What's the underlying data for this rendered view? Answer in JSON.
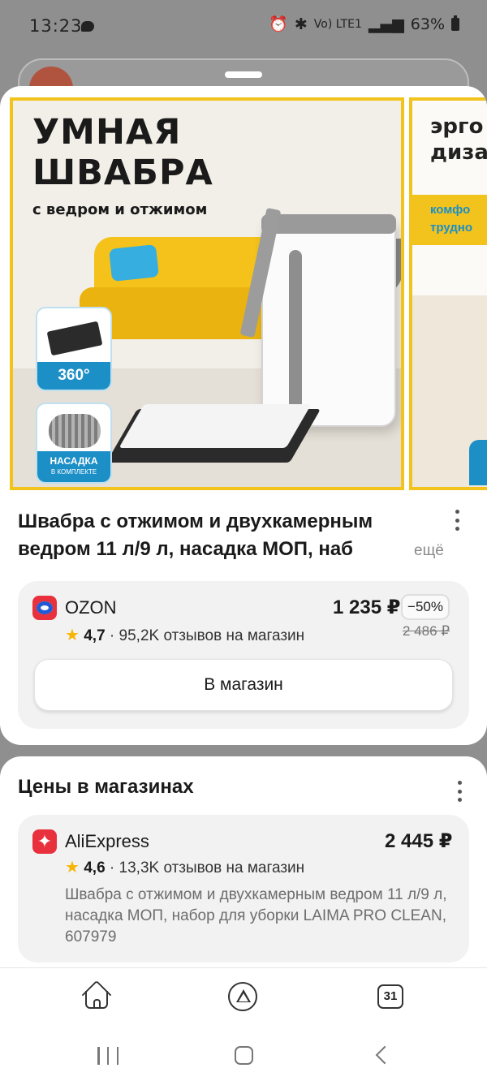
{
  "status": {
    "time": "13:23",
    "battery": "63%",
    "network": "Vo) LTE1"
  },
  "gallery": {
    "slide1": {
      "title_line1": "УМНАЯ",
      "title_line2": "ШВАБРА",
      "subtitle": "с ведром и отжимом",
      "badge_rotation": "360°",
      "badge_pad": "НАСАДКА",
      "badge_pad_sub": "В КОМПЛЕКТЕ"
    },
    "slide2": {
      "title_line1": "эрго",
      "title_line2": "диза",
      "band_line1": "комфо",
      "band_line2": "трудно"
    }
  },
  "product": {
    "title_line1": "Швабра с отжимом и двухкамерным",
    "title_line2": "ведром 11 л/9 л, насадка МОП, наб",
    "more_label": "ещё"
  },
  "best_offer": {
    "shop": "OZON",
    "rating": "4,7",
    "reviews": "· 95,2K отзывов на магазин",
    "price": "1 235 ₽",
    "discount": "−50%",
    "old_price": "2 486 ₽",
    "button_label": "В магазин"
  },
  "prices_section": {
    "title": "Цены в магазинах",
    "offers": [
      {
        "shop": "AliExpress",
        "rating": "4,6",
        "reviews": "· 13,3K отзывов на магазин",
        "price": "2 445 ₽",
        "description": "Швабра с отжимом и двухкамерным ведром 11 л/9 л, насадка МОП, набор для уборки LAIMA PRO CLEAN, 607979"
      }
    ]
  },
  "bottom_nav": {
    "calendar_day": "31"
  },
  "colors": {
    "accent_yellow": "#f2c31d",
    "star": "#f7b500",
    "ozon_red": "#e8313d",
    "ozon_blue": "#1f5bd6",
    "card_bg": "#f2f2f3"
  }
}
